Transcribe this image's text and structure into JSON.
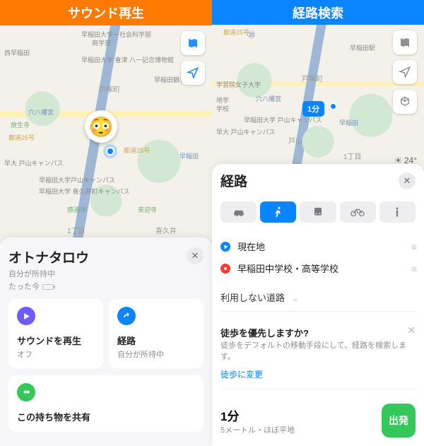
{
  "left": {
    "header": "サウンド再生",
    "map": {
      "labels": {
        "waseda_shakai": "早稲田大学ー社会科学部",
        "shogakubu": "商学部",
        "nishiwaseda": "西早稲田",
        "waseda_aizu": "早稲田大学 會津 八一記念博物館",
        "totsuka": "戸塚町",
        "waseda_tsuru": "早稲田鶴巻町",
        "anahachiman": "穴八幡宮",
        "route25": "都道25号",
        "route25b": "都道25号",
        "hoshoji": "放生寺",
        "waseda_toyama": "早大 戸山キャンパス",
        "waseda_line": "早稲田",
        "toyama_campus": "早稲田大学戸山キャンパス",
        "kikuicho": "早稲田大学 喜久井町キャンパス",
        "kansenji": "感通寺",
        "raikoji": "来迎寺",
        "kikui": "喜久井",
        "chome": "1丁目"
      }
    },
    "sheet": {
      "title": "オトナタロウ",
      "owner": "自分が所持中",
      "time": "たった今",
      "cards": {
        "sound": {
          "label": "サウンドを再生",
          "sub": "オフ"
        },
        "route": {
          "label": "経路",
          "sub": "自分が所持中"
        },
        "share": {
          "label": "この持ち物を共有"
        }
      }
    }
  },
  "right": {
    "header": "経路検索",
    "map": {
      "eta": "1分",
      "labels": {
        "route25": "都道25号",
        "seibu_rail": "⑳",
        "gakushuin": "学習院女子大学",
        "waseda_sta": "早稲田駅",
        "waseda_toyama": "早大 戸山キャンパス",
        "waseda_line": "早稲田",
        "anahachiman": "穴八幡宮",
        "totsuka": "戸塚町",
        "toyama": "戸山",
        "chigaku": "地学",
        "gakko": "学校",
        "toyama_campus": "早稲田大学 戸山キャンパス",
        "rail": "早稲田",
        "chome": "1丁目"
      },
      "weather": "24°"
    },
    "sheet": {
      "title": "経路",
      "modes": [
        "car",
        "walk",
        "transit",
        "bike",
        "other"
      ],
      "active_mode": "walk",
      "from": "現在地",
      "to": "早稲田中学校・高等学校",
      "avoid": "利用しない道路",
      "prompt": {
        "title": "徒歩を優先しますか?",
        "body": "徒歩をデフォルトの移動手段にして、経路を検索します。",
        "link": "徒歩に変更"
      },
      "eta": "1分",
      "dist": "5メートル・ほぼ平地",
      "go": "出発"
    }
  }
}
